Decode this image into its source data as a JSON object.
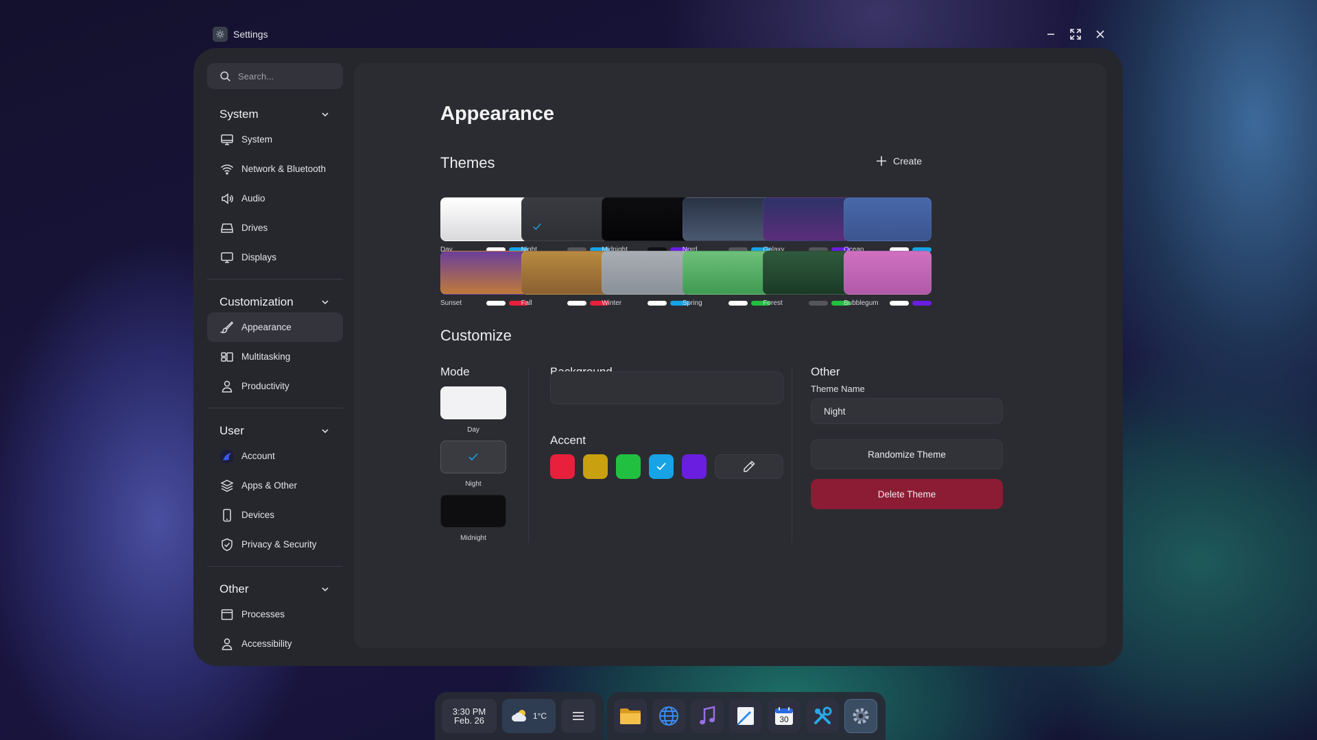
{
  "window": {
    "title": "Settings",
    "controls": {
      "minimize": "minimize-icon",
      "maximize": "maximize-icon",
      "close": "close-icon"
    }
  },
  "sidebar": {
    "search_placeholder": "Search...",
    "groups": [
      {
        "title": "System",
        "items": [
          {
            "label": "System",
            "icon": "monitor-icon"
          },
          {
            "label": "Network & Bluetooth",
            "icon": "wifi-icon"
          },
          {
            "label": "Audio",
            "icon": "speaker-icon"
          },
          {
            "label": "Drives",
            "icon": "drive-icon"
          },
          {
            "label": "Displays",
            "icon": "display-icon"
          }
        ]
      },
      {
        "title": "Customization",
        "items": [
          {
            "label": "Appearance",
            "icon": "brush-icon",
            "active": true
          },
          {
            "label": "Multitasking",
            "icon": "multitasking-icon"
          },
          {
            "label": "Productivity",
            "icon": "person-icon"
          }
        ]
      },
      {
        "title": "User",
        "items": [
          {
            "label": "Account",
            "icon": "avatar-icon"
          },
          {
            "label": "Apps & Other",
            "icon": "layers-icon"
          },
          {
            "label": "Devices",
            "icon": "phone-icon"
          },
          {
            "label": "Privacy & Security",
            "icon": "shield-icon"
          }
        ]
      },
      {
        "title": "Other",
        "items": [
          {
            "label": "Processes",
            "icon": "window-icon"
          },
          {
            "label": "Accessibility",
            "icon": "person-icon"
          }
        ]
      }
    ]
  },
  "main": {
    "title": "Appearance",
    "themes_title": "Themes",
    "create_label": "Create",
    "themes": [
      {
        "name": "Day",
        "gradient": [
          "#ffffff",
          "#d9d9dc"
        ],
        "pills": [
          "#ffffff",
          "#17a3e6"
        ]
      },
      {
        "name": "Night",
        "gradient": [
          "#3a3b40",
          "#2e2f34"
        ],
        "pills": [
          "#55565c",
          "#17a3e6"
        ],
        "selected": true
      },
      {
        "name": "Midnight",
        "gradient": [
          "#0d0d10",
          "#050507"
        ],
        "pills": [
          "#111114",
          "#6a1ee0"
        ]
      },
      {
        "name": "Nord",
        "gradient": [
          "#2a3346",
          "#4a5870"
        ],
        "pills": [
          "#55565c",
          "#17a3e6"
        ]
      },
      {
        "name": "Galaxy",
        "gradient": [
          "#2e3268",
          "#5a2e7a"
        ],
        "pills": [
          "#55565c",
          "#6a1ee0"
        ]
      },
      {
        "name": "Ocean",
        "gradient": [
          "#4868a8",
          "#3b5590"
        ],
        "pills": [
          "#ffffff",
          "#17a3e6"
        ]
      },
      {
        "name": "Sunset",
        "gradient": [
          "#6a3f9a",
          "#c07a3a"
        ],
        "pills": [
          "#ffffff",
          "#e8203c"
        ]
      },
      {
        "name": "Fall",
        "gradient": [
          "#b88a40",
          "#8a6030"
        ],
        "pills": [
          "#ffffff",
          "#e8203c"
        ]
      },
      {
        "name": "Winter",
        "gradient": [
          "#a8aeb4",
          "#8a9098"
        ],
        "pills": [
          "#ffffff",
          "#17a3e6"
        ]
      },
      {
        "name": "Spring",
        "gradient": [
          "#6ec07a",
          "#3f9a52"
        ],
        "pills": [
          "#ffffff",
          "#22c040"
        ]
      },
      {
        "name": "Forest",
        "gradient": [
          "#2f5a3c",
          "#1a3a26"
        ],
        "pills": [
          "#55565c",
          "#22c040"
        ]
      },
      {
        "name": "Bubblegum",
        "gradient": [
          "#d070c0",
          "#b05aa8"
        ],
        "pills": [
          "#ffffff",
          "#6a1ee0"
        ]
      }
    ],
    "customize_title": "Customize",
    "mode": {
      "title": "Mode",
      "options": [
        {
          "label": "Day",
          "color": "#f2f2f4"
        },
        {
          "label": "Night",
          "color": "#3a3b40",
          "selected": true
        },
        {
          "label": "Midnight",
          "color": "#0e0e11"
        }
      ]
    },
    "background": {
      "title": "Background"
    },
    "accent": {
      "title": "Accent",
      "colors": [
        "#e8203c",
        "#c8a010",
        "#22c040",
        "#17a3e6",
        "#6a1ee0"
      ],
      "selected_index": 3
    },
    "other": {
      "title": "Other",
      "theme_name_label": "Theme Name",
      "theme_name_value": "Night",
      "randomize_label": "Randomize Theme",
      "delete_label": "Delete Theme"
    }
  },
  "taskbar": {
    "time": "3:30 PM",
    "date": "Feb. 26",
    "weather": "1°C",
    "apps": [
      "folder-icon",
      "globe-icon",
      "music-icon",
      "notes-icon",
      "calendar-icon",
      "tools-icon",
      "settings-icon"
    ],
    "calendar_day": "30",
    "active_app": "settings-icon"
  }
}
